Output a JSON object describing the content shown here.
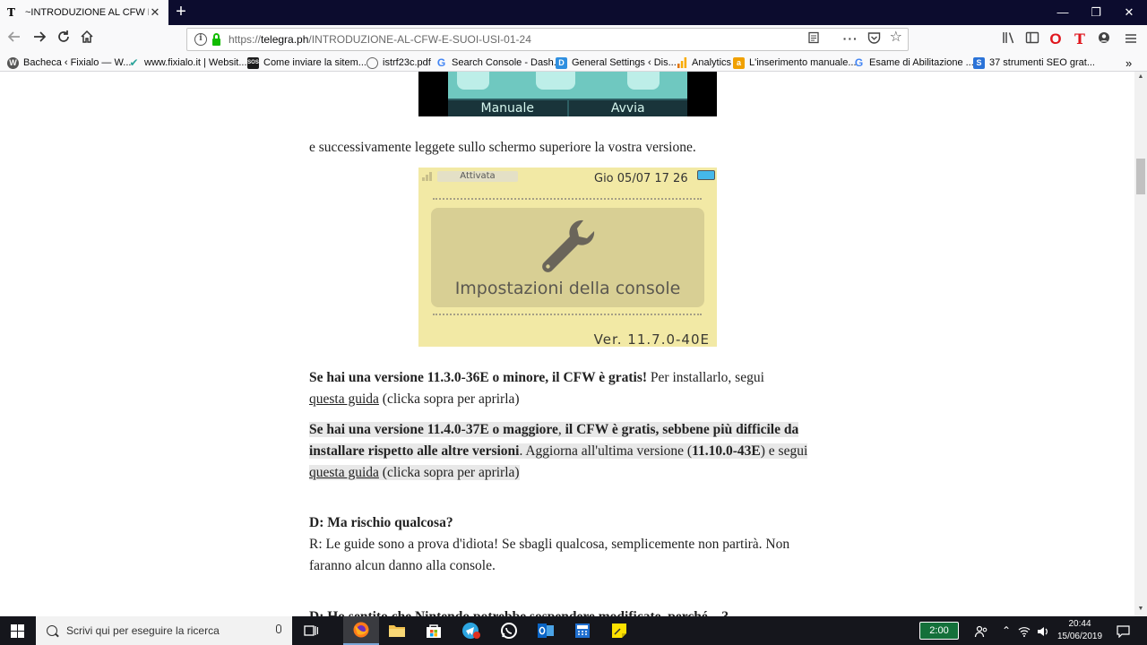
{
  "browser": {
    "tab_title": "~INTRODUZIONE AL CFW E SU",
    "tab_favicon": "T",
    "new_tab": "+",
    "window": {
      "minimize": "—",
      "restore": "❐",
      "close": "✕"
    },
    "url_prefix": "https://",
    "url_host": "telegra.ph",
    "url_path": "/INTRODUZIONE-AL-CFW-E-SUOI-USI-01-24",
    "icons": [
      "back-icon",
      "forward-icon",
      "reload-icon",
      "home-icon",
      "reader-view-icon",
      "page-actions-icon",
      "pocket-icon",
      "bookmark-star-icon",
      "library-icon",
      "sidebar-icon",
      "opera-icon",
      "telegram-t-icon",
      "account-icon",
      "menu-icon"
    ]
  },
  "bookmarks": [
    {
      "label": "Bacheca ‹ Fixialo — W...",
      "icon_color": "#555555",
      "icon": "wordpress-icon"
    },
    {
      "label": "www.fixialo.it | Websit...",
      "icon_color": "#2aa39a",
      "icon": "check-icon"
    },
    {
      "label": "Come inviare la sitem...",
      "icon_color": "#1d1d1d",
      "icon": "sos-icon"
    },
    {
      "label": "istrf23c.pdf",
      "icon_color": "#666666",
      "icon": "globe-icon"
    },
    {
      "label": "Search Console - Dash...",
      "icon_color": "#4285f4",
      "icon": "google-icon"
    },
    {
      "label": "General Settings ‹ Dis...",
      "icon_color": "#2f8fe0",
      "icon": "d-icon"
    },
    {
      "label": "Analytics",
      "icon_color": "#f4a300",
      "icon": "analytics-icon"
    },
    {
      "label": "L'inserimento manuale...",
      "icon_color": "#f0a000",
      "icon": "a-icon"
    },
    {
      "label": "Esame di Abilitazione ...",
      "icon_color": "#4285f4",
      "icon": "google-icon"
    },
    {
      "label": "37 strumenti SEO grat...",
      "icon_color": "#2b73d8",
      "icon": "s-icon"
    }
  ],
  "content": {
    "top_image_buttons": [
      "Manuale",
      "Avvia"
    ],
    "line_1": "e successivamente leggete sullo schermo superiore la vostra versione.",
    "console_screen": {
      "status": "Attivata",
      "clock": "Gio 05/07  17 26",
      "label": "Impostazioni della console",
      "version": "Ver. 11.7.0-40E"
    },
    "p1_bold": "Se hai una versione 11.3.0-36E o minore, il CFW è gratis!",
    "p1_rest": " Per installarlo, segui",
    "p1_link": "questa guida",
    "p1_tail": " (clicka sopra per aprirla)",
    "p2_bold1": "Se hai una versione 11.4.0-37E o maggiore",
    "p2_comma": ", ",
    "p2_bold2": "il CFW è gratis, sebbene più difficile da installare rispetto alle altre versioni",
    "p2_rest": ". Aggiorna all'ultima versione (",
    "p2_ver": "11.10.0-43E",
    "p2_rest2": ") e segui ",
    "p2_link": "questa guida",
    "p2_tail": " (clicka sopra per aprirla)",
    "q": "D: Ma rischio qualcosa?",
    "a": "R: Le guide sono a prova d'idiota! Se sbagli qualcosa, semplicemente non partirà. Non faranno alcun danno alla console.",
    "next_q_partial": "D: Ho sentito che Nintendo potrebbe sospendere modificate, perché ...?"
  },
  "taskbar": {
    "search_placeholder": "Scrivi qui per eseguire la ricerca",
    "battery": "2:00",
    "time": "20:44",
    "date": "15/06/2019",
    "apps": [
      "task-view-icon",
      "firefox-icon",
      "file-explorer-icon",
      "store-icon",
      "telegram-icon",
      "whatsapp-icon",
      "outlook-icon",
      "calculator-icon",
      "sticky-notes-icon"
    ]
  }
}
